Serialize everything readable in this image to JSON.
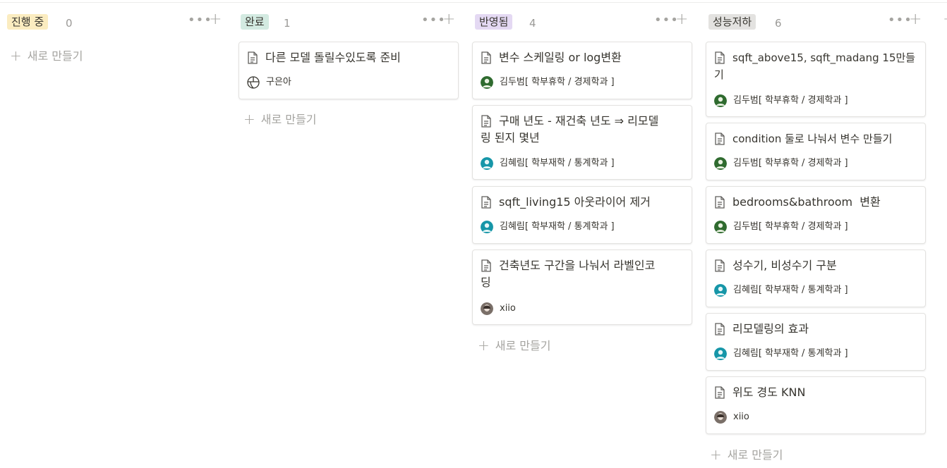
{
  "board": {
    "columns": [
      {
        "tag": "진행 중",
        "tag_color": "#fbecc0",
        "count": "0",
        "new_label": "새로 만들기",
        "cards": []
      },
      {
        "tag": "완료",
        "tag_color": "#d3eae1",
        "count": "1",
        "new_label": "새로 만들기",
        "cards": [
          {
            "title": "다른 모델 돌릴수있도록 준비",
            "person": "구은아",
            "avatar": "globe-avatar"
          }
        ]
      },
      {
        "tag": "반영됨",
        "tag_color": "#e4d9f3",
        "count": "4",
        "new_label": "새로 만들기",
        "cards": [
          {
            "title": "변수 스케일링 or log변환",
            "person": "김두범[ 학부휴학 / 경제학과 ]",
            "avatar": "green-avatar"
          },
          {
            "title_line1": "구매 년도 - 재건축 년도 ⇒ 리모델",
            "title_line2": "링 된지 몇년",
            "person": "김혜림[ 학부재학 / 통계학과 ]",
            "avatar": "teal-avatar"
          },
          {
            "title": "sqft_living15 아웃라이어 제거",
            "person": "김혜림[ 학부재학 / 통계학과 ]",
            "avatar": "teal-avatar"
          },
          {
            "title_line1": "건축년도 구간을 나눠서 라벨인코",
            "title_line2": "딩",
            "person": "xiio",
            "avatar": "photo-avatar"
          }
        ]
      },
      {
        "tag": "성능저하",
        "tag_color": "#e3e2e0",
        "count": "6",
        "new_label": "새로 만들기",
        "cards": [
          {
            "title_line1": "sqft_above15, sqft_madang 15만들",
            "title_line2": "기",
            "person": "김두범[ 학부휴학 / 경제학과 ]",
            "avatar": "green-avatar"
          },
          {
            "title": "condition 둘로 나눠서 변수 만들기",
            "person": "김두범[ 학부휴학 / 경제학과 ]",
            "avatar": "green-avatar"
          },
          {
            "title": "bedrooms&bathroom  변환",
            "person": "김두범[ 학부휴학 / 경제학과 ]",
            "avatar": "green-avatar"
          },
          {
            "title": "성수기, 비성수기 구분",
            "person": "김혜림[ 학부재학 / 통계학과 ]",
            "avatar": "teal-avatar"
          },
          {
            "title": "리모델링의 효과",
            "person": "김혜림[ 학부재학 / 통계학과 ]",
            "avatar": "teal-avatar"
          },
          {
            "title": "위도 경도 KNN",
            "person": "xiio",
            "avatar": "photo-avatar"
          }
        ]
      }
    ]
  },
  "icons": {
    "more": "more-icon",
    "add": "plus-icon",
    "page": "page-icon"
  },
  "glyphs": {
    "dots": "•••",
    "plus": "+"
  }
}
